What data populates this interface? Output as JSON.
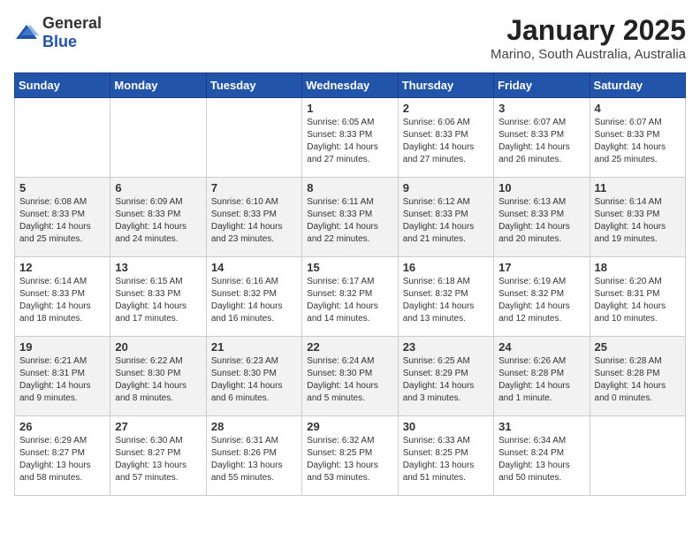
{
  "header": {
    "logo_general": "General",
    "logo_blue": "Blue",
    "month_title": "January 2025",
    "location": "Marino, South Australia, Australia"
  },
  "days_of_week": [
    "Sunday",
    "Monday",
    "Tuesday",
    "Wednesday",
    "Thursday",
    "Friday",
    "Saturday"
  ],
  "weeks": [
    [
      {
        "day": "",
        "info": ""
      },
      {
        "day": "",
        "info": ""
      },
      {
        "day": "",
        "info": ""
      },
      {
        "day": "1",
        "info": "Sunrise: 6:05 AM\nSunset: 8:33 PM\nDaylight: 14 hours and 27 minutes."
      },
      {
        "day": "2",
        "info": "Sunrise: 6:06 AM\nSunset: 8:33 PM\nDaylight: 14 hours and 27 minutes."
      },
      {
        "day": "3",
        "info": "Sunrise: 6:07 AM\nSunset: 8:33 PM\nDaylight: 14 hours and 26 minutes."
      },
      {
        "day": "4",
        "info": "Sunrise: 6:07 AM\nSunset: 8:33 PM\nDaylight: 14 hours and 25 minutes."
      }
    ],
    [
      {
        "day": "5",
        "info": "Sunrise: 6:08 AM\nSunset: 8:33 PM\nDaylight: 14 hours and 25 minutes."
      },
      {
        "day": "6",
        "info": "Sunrise: 6:09 AM\nSunset: 8:33 PM\nDaylight: 14 hours and 24 minutes."
      },
      {
        "day": "7",
        "info": "Sunrise: 6:10 AM\nSunset: 8:33 PM\nDaylight: 14 hours and 23 minutes."
      },
      {
        "day": "8",
        "info": "Sunrise: 6:11 AM\nSunset: 8:33 PM\nDaylight: 14 hours and 22 minutes."
      },
      {
        "day": "9",
        "info": "Sunrise: 6:12 AM\nSunset: 8:33 PM\nDaylight: 14 hours and 21 minutes."
      },
      {
        "day": "10",
        "info": "Sunrise: 6:13 AM\nSunset: 8:33 PM\nDaylight: 14 hours and 20 minutes."
      },
      {
        "day": "11",
        "info": "Sunrise: 6:14 AM\nSunset: 8:33 PM\nDaylight: 14 hours and 19 minutes."
      }
    ],
    [
      {
        "day": "12",
        "info": "Sunrise: 6:14 AM\nSunset: 8:33 PM\nDaylight: 14 hours and 18 minutes."
      },
      {
        "day": "13",
        "info": "Sunrise: 6:15 AM\nSunset: 8:33 PM\nDaylight: 14 hours and 17 minutes."
      },
      {
        "day": "14",
        "info": "Sunrise: 6:16 AM\nSunset: 8:32 PM\nDaylight: 14 hours and 16 minutes."
      },
      {
        "day": "15",
        "info": "Sunrise: 6:17 AM\nSunset: 8:32 PM\nDaylight: 14 hours and 14 minutes."
      },
      {
        "day": "16",
        "info": "Sunrise: 6:18 AM\nSunset: 8:32 PM\nDaylight: 14 hours and 13 minutes."
      },
      {
        "day": "17",
        "info": "Sunrise: 6:19 AM\nSunset: 8:32 PM\nDaylight: 14 hours and 12 minutes."
      },
      {
        "day": "18",
        "info": "Sunrise: 6:20 AM\nSunset: 8:31 PM\nDaylight: 14 hours and 10 minutes."
      }
    ],
    [
      {
        "day": "19",
        "info": "Sunrise: 6:21 AM\nSunset: 8:31 PM\nDaylight: 14 hours and 9 minutes."
      },
      {
        "day": "20",
        "info": "Sunrise: 6:22 AM\nSunset: 8:30 PM\nDaylight: 14 hours and 8 minutes."
      },
      {
        "day": "21",
        "info": "Sunrise: 6:23 AM\nSunset: 8:30 PM\nDaylight: 14 hours and 6 minutes."
      },
      {
        "day": "22",
        "info": "Sunrise: 6:24 AM\nSunset: 8:30 PM\nDaylight: 14 hours and 5 minutes."
      },
      {
        "day": "23",
        "info": "Sunrise: 6:25 AM\nSunset: 8:29 PM\nDaylight: 14 hours and 3 minutes."
      },
      {
        "day": "24",
        "info": "Sunrise: 6:26 AM\nSunset: 8:28 PM\nDaylight: 14 hours and 1 minute."
      },
      {
        "day": "25",
        "info": "Sunrise: 6:28 AM\nSunset: 8:28 PM\nDaylight: 14 hours and 0 minutes."
      }
    ],
    [
      {
        "day": "26",
        "info": "Sunrise: 6:29 AM\nSunset: 8:27 PM\nDaylight: 13 hours and 58 minutes."
      },
      {
        "day": "27",
        "info": "Sunrise: 6:30 AM\nSunset: 8:27 PM\nDaylight: 13 hours and 57 minutes."
      },
      {
        "day": "28",
        "info": "Sunrise: 6:31 AM\nSunset: 8:26 PM\nDaylight: 13 hours and 55 minutes."
      },
      {
        "day": "29",
        "info": "Sunrise: 6:32 AM\nSunset: 8:25 PM\nDaylight: 13 hours and 53 minutes."
      },
      {
        "day": "30",
        "info": "Sunrise: 6:33 AM\nSunset: 8:25 PM\nDaylight: 13 hours and 51 minutes."
      },
      {
        "day": "31",
        "info": "Sunrise: 6:34 AM\nSunset: 8:24 PM\nDaylight: 13 hours and 50 minutes."
      },
      {
        "day": "",
        "info": ""
      }
    ]
  ]
}
